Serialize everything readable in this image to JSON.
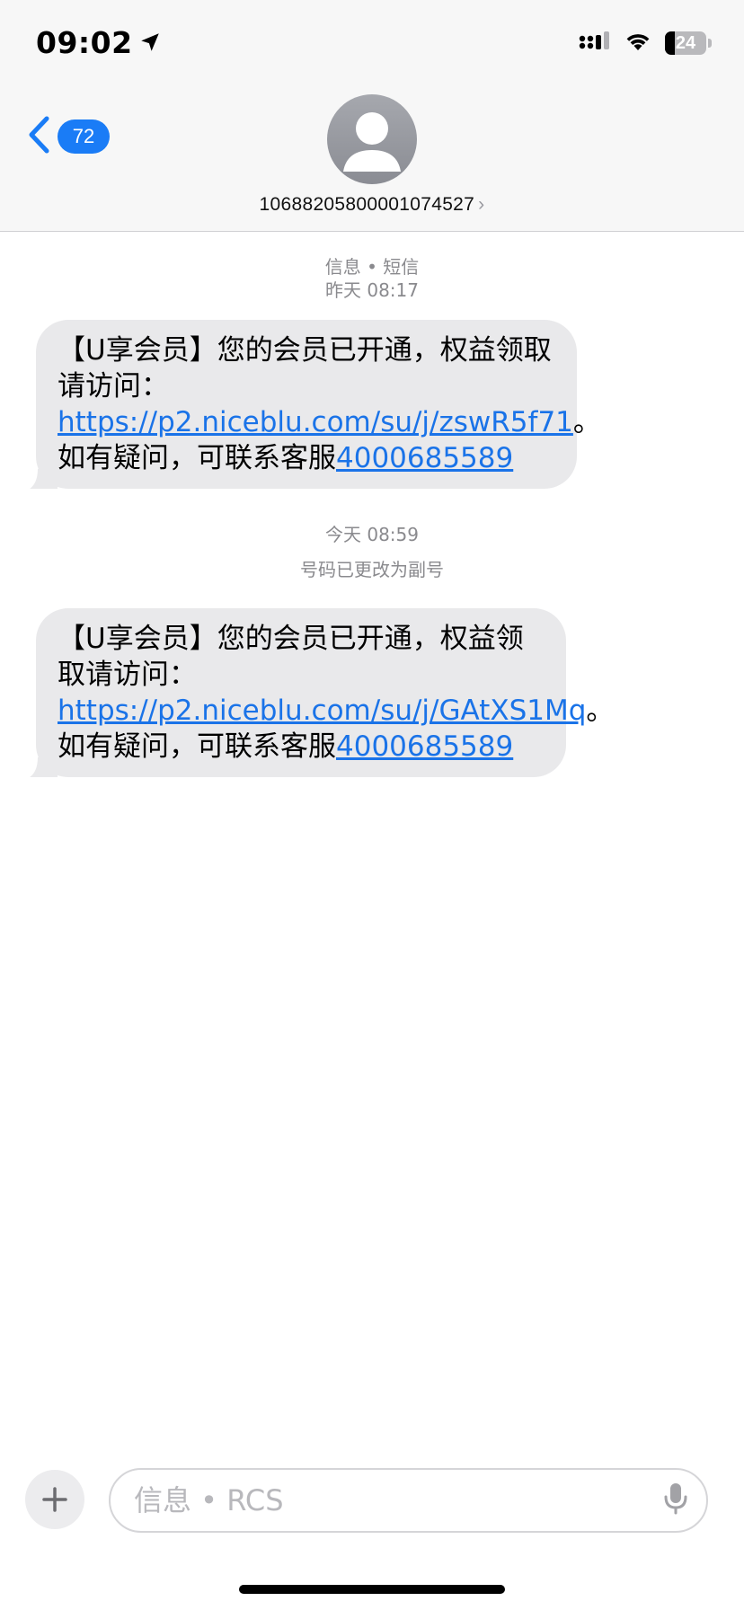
{
  "status_bar": {
    "time": "09:02",
    "battery_level": "24",
    "battery_fraction": 0.24
  },
  "nav": {
    "back_badge": "72",
    "contact_number": "10688205800001074527",
    "contact_chevron": "›"
  },
  "thread": {
    "header_service": "信息 • 短信",
    "header_time": "昨天 08:17",
    "second_time": "今天 08:59",
    "number_change_notice": "号码已更改为副号"
  },
  "messages": [
    {
      "prefix": "【U享会员】您的会员已开通，权益领取请访问：",
      "link": "https://p2.niceblu.com/su/j/zswR5f71",
      "middle": "。如有疑问，可联系客服",
      "phone": "4000685589"
    },
    {
      "prefix": "【U享会员】您的会员已开通，权益领取请访问：",
      "link": "https://p2.niceblu.com/su/j/GAtXS1Mq",
      "middle": "。如有疑问，可联系客服",
      "phone": "4000685589"
    }
  ],
  "composer": {
    "placeholder": "信息 • RCS"
  },
  "colors": {
    "accent": "#1a7cf6",
    "link": "#1a73e8",
    "bubble": "#e9e9eb",
    "meta_text": "#8a8a8e"
  },
  "icons": {
    "location": "location-arrow-icon",
    "signal": "cellular-signal-icon",
    "wifi": "wifi-icon",
    "battery": "battery-icon",
    "back": "chevron-left-icon",
    "avatar": "person-icon",
    "plus": "plus-icon",
    "mic": "microphone-icon"
  }
}
